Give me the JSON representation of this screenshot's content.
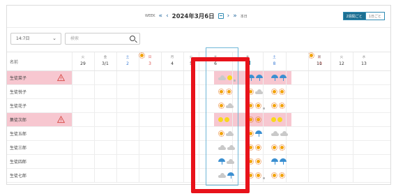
{
  "nav": {
    "week_label": "WEEK",
    "prev_week": "«",
    "prev_day": "‹",
    "date": "2024年3月6日",
    "next_day": "›",
    "next_week": "»",
    "today_label": "本日"
  },
  "view_toggle": {
    "active": "2週間ごと",
    "inactive": "1日ごと"
  },
  "filters": {
    "select_value": "14:7日",
    "search_placeholder": "検索"
  },
  "header": {
    "name_label": "名前"
  },
  "days": [
    {
      "wd": "火",
      "day": "29",
      "type": "normal"
    },
    {
      "wd": "金",
      "day": "3/1",
      "type": "normal"
    },
    {
      "wd": "土",
      "day": "2",
      "type": "sat"
    },
    {
      "wd": "日",
      "day": "3",
      "type": "sun"
    },
    {
      "wd": "月",
      "day": "4",
      "type": "normal"
    },
    {
      "wd": "火",
      "day": "5",
      "type": "normal"
    },
    {
      "wd": "水",
      "day": "6",
      "type": "normal"
    },
    {
      "wd": "木",
      "day": "7",
      "type": "today"
    },
    {
      "wd": "土",
      "day": "8",
      "type": "sat"
    },
    {
      "wd": "日",
      "day": "10",
      "type": "sun"
    },
    {
      "wd": "月",
      "day": "11",
      "type": "normal"
    },
    {
      "wd": "火",
      "day": "12",
      "type": "normal"
    },
    {
      "wd": "水",
      "day": "13",
      "type": "normal"
    }
  ],
  "employees": [
    {
      "name": "生徒菜子",
      "warning": true,
      "highlight": true,
      "a": [
        "cloud",
        "yellow",
        "dot"
      ],
      "b": [
        "umb",
        "umb"
      ],
      "c": [
        "umb",
        "umb"
      ]
    },
    {
      "name": "生徒悦子",
      "warning": false,
      "highlight": false,
      "a": [
        "sun",
        "sun"
      ],
      "b": [
        "sun",
        "cloud"
      ],
      "c": [
        "sun",
        "sun"
      ]
    },
    {
      "name": "生徒花子",
      "warning": false,
      "highlight": false,
      "a": [
        "sun",
        "cloud"
      ],
      "b": [
        "sun",
        "sun",
        "dot"
      ],
      "c": [
        "sun",
        "sun"
      ]
    },
    {
      "name": "集徒次郎",
      "warning": true,
      "highlight": true,
      "a": [
        "yellow",
        "yellow"
      ],
      "b": [
        "sun",
        "sun"
      ],
      "c": [
        "yellow",
        "yellow"
      ]
    },
    {
      "name": "生徒五郎",
      "warning": false,
      "highlight": false,
      "a": [
        "sun",
        "cloud"
      ],
      "b": [
        "sun",
        "umb"
      ],
      "c": [
        "cloud",
        "cloud"
      ]
    },
    {
      "name": "生徒三郎",
      "warning": false,
      "highlight": false,
      "a": [
        "cloud",
        "cloud"
      ],
      "b": [
        "sun",
        "sun"
      ],
      "c": [
        "sun",
        "sun"
      ]
    },
    {
      "name": "生徒四郎",
      "warning": false,
      "highlight": false,
      "a": [
        "umb",
        "cloud"
      ],
      "b": [
        "sun",
        "sun"
      ],
      "c": [
        "umb",
        "umb"
      ]
    },
    {
      "name": "生徒七郎",
      "warning": false,
      "highlight": false,
      "a": [
        "cloud",
        "umb"
      ],
      "b": [
        "sun",
        "sun",
        "dot"
      ],
      "c": [
        "sun",
        "sun"
      ]
    }
  ],
  "colors": {
    "accent": "#1c6f92",
    "highlight_row": "#f7c7d0",
    "callout": "#e8121a",
    "warning": "#d9534f"
  }
}
